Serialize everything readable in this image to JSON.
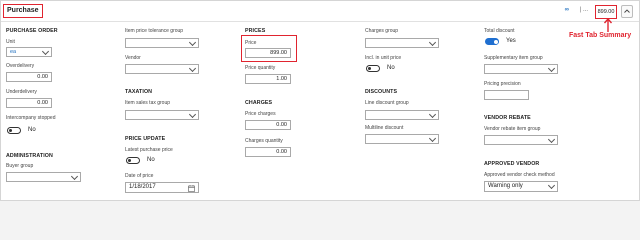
{
  "header": {
    "title": "Purchase",
    "link_icon_text": "∞",
    "separator": "|",
    "more_text": "...",
    "summary_value": "899.00",
    "callout": "Fast Tab Summary"
  },
  "col1": {
    "purchase_order": "PURCHASE ORDER",
    "unit_label": "Unit",
    "unit_value": "ea",
    "overdelivery_label": "Overdelivery",
    "overdelivery_value": "0.00",
    "underdelivery_label": "Underdelivery",
    "underdelivery_value": "0.00",
    "intercompany_label": "Intercompany stopped",
    "intercompany_toggle": "No",
    "administration": "ADMINISTRATION",
    "buyer_group_label": "Buyer group"
  },
  "col2": {
    "tolerance_label": "Item price tolerance group",
    "vendor_label": "Vendor",
    "taxation": "TAXATION",
    "sales_tax_label": "Item sales tax group",
    "price_update": "PRICE UPDATE",
    "latest_price_label": "Latest purchase price",
    "latest_price_toggle": "No",
    "date_of_price_label": "Date of price",
    "date_of_price_value": "1/18/2017"
  },
  "col3": {
    "prices": "PRICES",
    "price_label": "Price",
    "price_value": "899.00",
    "price_qty_label": "Price quantity",
    "price_qty_value": "1.00",
    "charges": "CHARGES",
    "price_charges_label": "Price charges",
    "price_charges_value": "0.00",
    "charges_qty_label": "Charges quantity",
    "charges_qty_value": "0.00"
  },
  "col4": {
    "charges_group_label": "Charges group",
    "incl_label": "Incl. in unit price",
    "incl_toggle": "No",
    "discounts": "DISCOUNTS",
    "line_discount_label": "Line discount group",
    "multiline_label": "Multiline discount"
  },
  "col5": {
    "total_discount_label": "Total discount",
    "total_discount_toggle": "Yes",
    "supp_item_label": "Supplementary item group",
    "pricing_precision_label": "Pricing precision",
    "vendor_rebate": "VENDOR REBATE",
    "vendor_rebate_group_label": "Vendor rebate item group",
    "approved_vendor": "APPROVED VENDOR",
    "approved_method_label": "Approved vendor check method",
    "approved_method_value": "Warning only"
  },
  "colors": {
    "highlight": "#e0242f",
    "toggle_on": "#1f6fd0",
    "link": "#1f6fbf"
  }
}
